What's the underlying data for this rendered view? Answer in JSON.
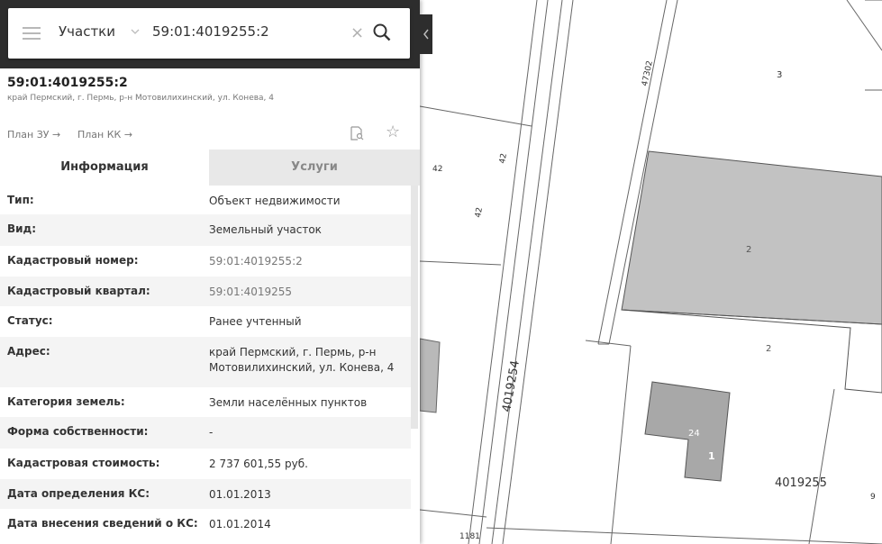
{
  "search": {
    "layer": "Участки",
    "query": "59:01:4019255:2"
  },
  "card": {
    "title": "59:01:4019255:2",
    "address": "край Пермский, г. Пермь, р-н Мотовилихинский, ул. Конева, 4",
    "plan_zu": "План ЗУ →",
    "plan_kk": "План КК →"
  },
  "tabs": [
    {
      "label": "Информация",
      "active": true
    },
    {
      "label": "Услуги",
      "active": false
    }
  ],
  "info_rows": [
    {
      "label": "Тип:",
      "value": "Объект недвижимости"
    },
    {
      "label": "Вид:",
      "value": "Земельный участок"
    },
    {
      "label": "Кадастровый номер:",
      "value": "59:01:4019255:2"
    },
    {
      "label": "Кадастровый квартал:",
      "value": "59:01:4019255"
    },
    {
      "label": "Статус:",
      "value": "Ранее учтенный"
    },
    {
      "label": "Адрес:",
      "value": "край Пермский, г. Пермь, р-н Мотовилихинский, ул. Конева, 4"
    },
    {
      "label": "Категория земель:",
      "value": "Земли населённых пунктов"
    },
    {
      "label": "Форма собственности:",
      "value": "-"
    },
    {
      "label": "Кадастровая стоимость:",
      "value": "2 737 601,55 руб."
    },
    {
      "label": "Дата определения КС:",
      "value": "01.01.2013"
    },
    {
      "label": "Дата внесения сведений о КС:",
      "value": "01.01.2014"
    }
  ],
  "map_labels": {
    "parcel_3": "3",
    "parcel_2_top": "2",
    "parcel_2_mid": "2",
    "parcel_24": "24",
    "building_1": "1",
    "quarter_4019255": "4019255",
    "quarter_4019254": "4019254",
    "road_47302": "47302",
    "parcel_42_a": "42",
    "parcel_42_b": "42",
    "parcel_42_c": "42",
    "parcel_9": "9",
    "parcel_1181": "1181"
  }
}
